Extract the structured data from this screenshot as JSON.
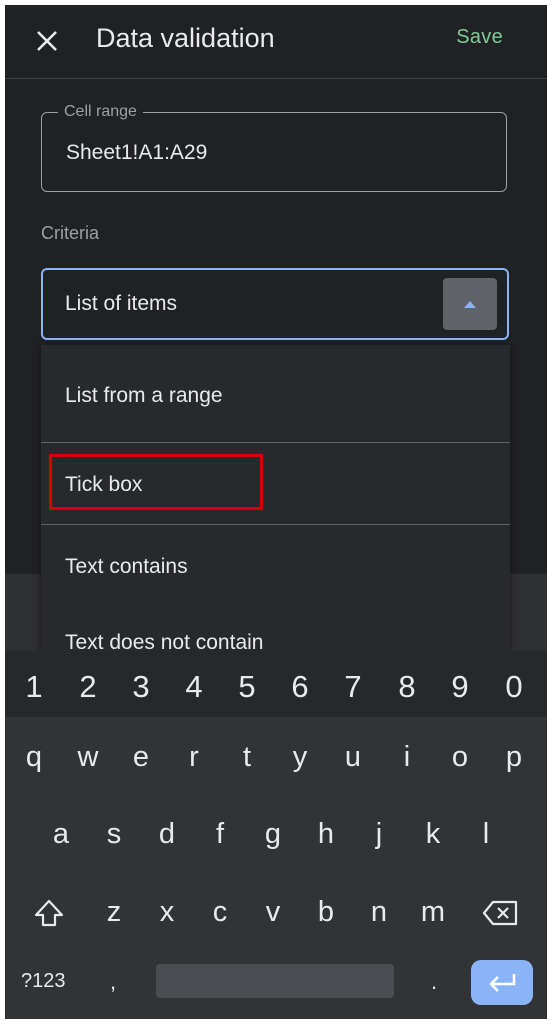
{
  "header": {
    "title": "Data validation",
    "save_label": "Save"
  },
  "cell_range": {
    "label": "Cell range",
    "value": "Sheet1!A1:A29"
  },
  "criteria": {
    "label": "Criteria",
    "selected": "List of items"
  },
  "menu": {
    "items": [
      {
        "label": "List from a range"
      },
      {
        "label": "Tick box"
      },
      {
        "label": "Text contains"
      },
      {
        "label": "Text does not contain"
      }
    ],
    "highlighted": "Tick box"
  },
  "keyboard": {
    "numbers": [
      "1",
      "2",
      "3",
      "4",
      "5",
      "6",
      "7",
      "8",
      "9",
      "0"
    ],
    "row1": [
      "q",
      "w",
      "e",
      "r",
      "t",
      "y",
      "u",
      "i",
      "o",
      "p"
    ],
    "row2": [
      "a",
      "s",
      "d",
      "f",
      "g",
      "h",
      "j",
      "k",
      "l"
    ],
    "row3": [
      "z",
      "x",
      "c",
      "v",
      "b",
      "n",
      "m"
    ],
    "symbols_label": "?123",
    "comma": ",",
    "period": "."
  },
  "colors": {
    "accent": "#8ab4f8",
    "save": "#81c995",
    "highlight": "#d60000",
    "background": "#202124"
  }
}
